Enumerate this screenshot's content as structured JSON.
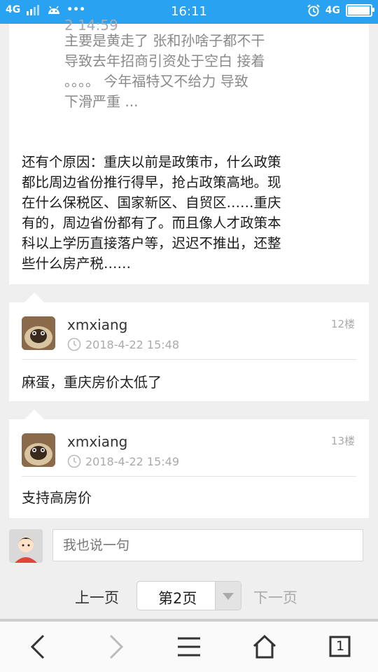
{
  "status_bar": {
    "network_left": "4G",
    "time": "16:11",
    "network_right": "4G"
  },
  "top_card": {
    "quote_timestamp": "2 14:59",
    "quote_lines": [
      "主要是黄走了 张和孙啥子都不干",
      "导致去年招商引资处于空白 接着",
      "。。。。 今年福特又不给力 导致",
      "下滑严重  ..."
    ],
    "reply_lines": [
      "还有个原因：重庆以前是政策市，什么政策",
      "都比周边省份推行得早，抢占政策高地。现",
      "在什么保税区、国家新区、自贸区……重庆",
      "有的，周边省份都有了。而且像人才政策本",
      "科以上学历直接落户等，迟迟不推出，还整",
      "些什么房产税……"
    ]
  },
  "posts": [
    {
      "username": "xmxiang",
      "time": "2018-4-22 15:48",
      "floor": "12楼",
      "text": "麻蛋，重庆房价太低了"
    },
    {
      "username": "xmxiang",
      "time": "2018-4-22 15:49",
      "floor": "13楼",
      "text": "支持高房价"
    }
  ],
  "composer": {
    "placeholder": "我也说一句"
  },
  "pagination": {
    "prev": "上一页",
    "current": "第2页",
    "next": "下一页"
  },
  "nav": {
    "back_icon": "chevron-left-icon",
    "forward_icon": "chevron-right-icon",
    "menu_icon": "hamburger-icon",
    "home_icon": "home-icon",
    "tabs_count": "1"
  },
  "colors": {
    "status_bar": "#2aa2f2",
    "background": "#efefef",
    "card": "#ffffff"
  }
}
